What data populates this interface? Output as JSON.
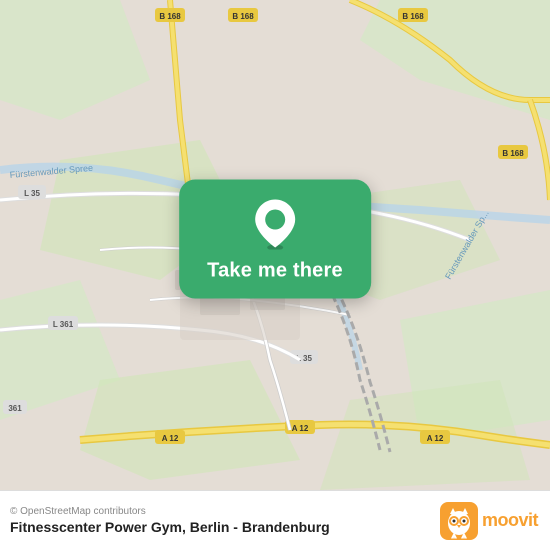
{
  "map": {
    "copyright": "© OpenStreetMap contributors",
    "button_label": "Take me there"
  },
  "footer": {
    "location_title": "Fitnesscenter Power Gym, Berlin - Brandenburg",
    "moovit_text": "moovit"
  },
  "colors": {
    "green": "#3aab6d",
    "orange": "#f7a030",
    "road_yellow": "#f5d56e",
    "road_white": "#ffffff",
    "map_bg": "#e8e0d8",
    "green_area": "#c8ddb8",
    "water": "#b8d4e8"
  }
}
